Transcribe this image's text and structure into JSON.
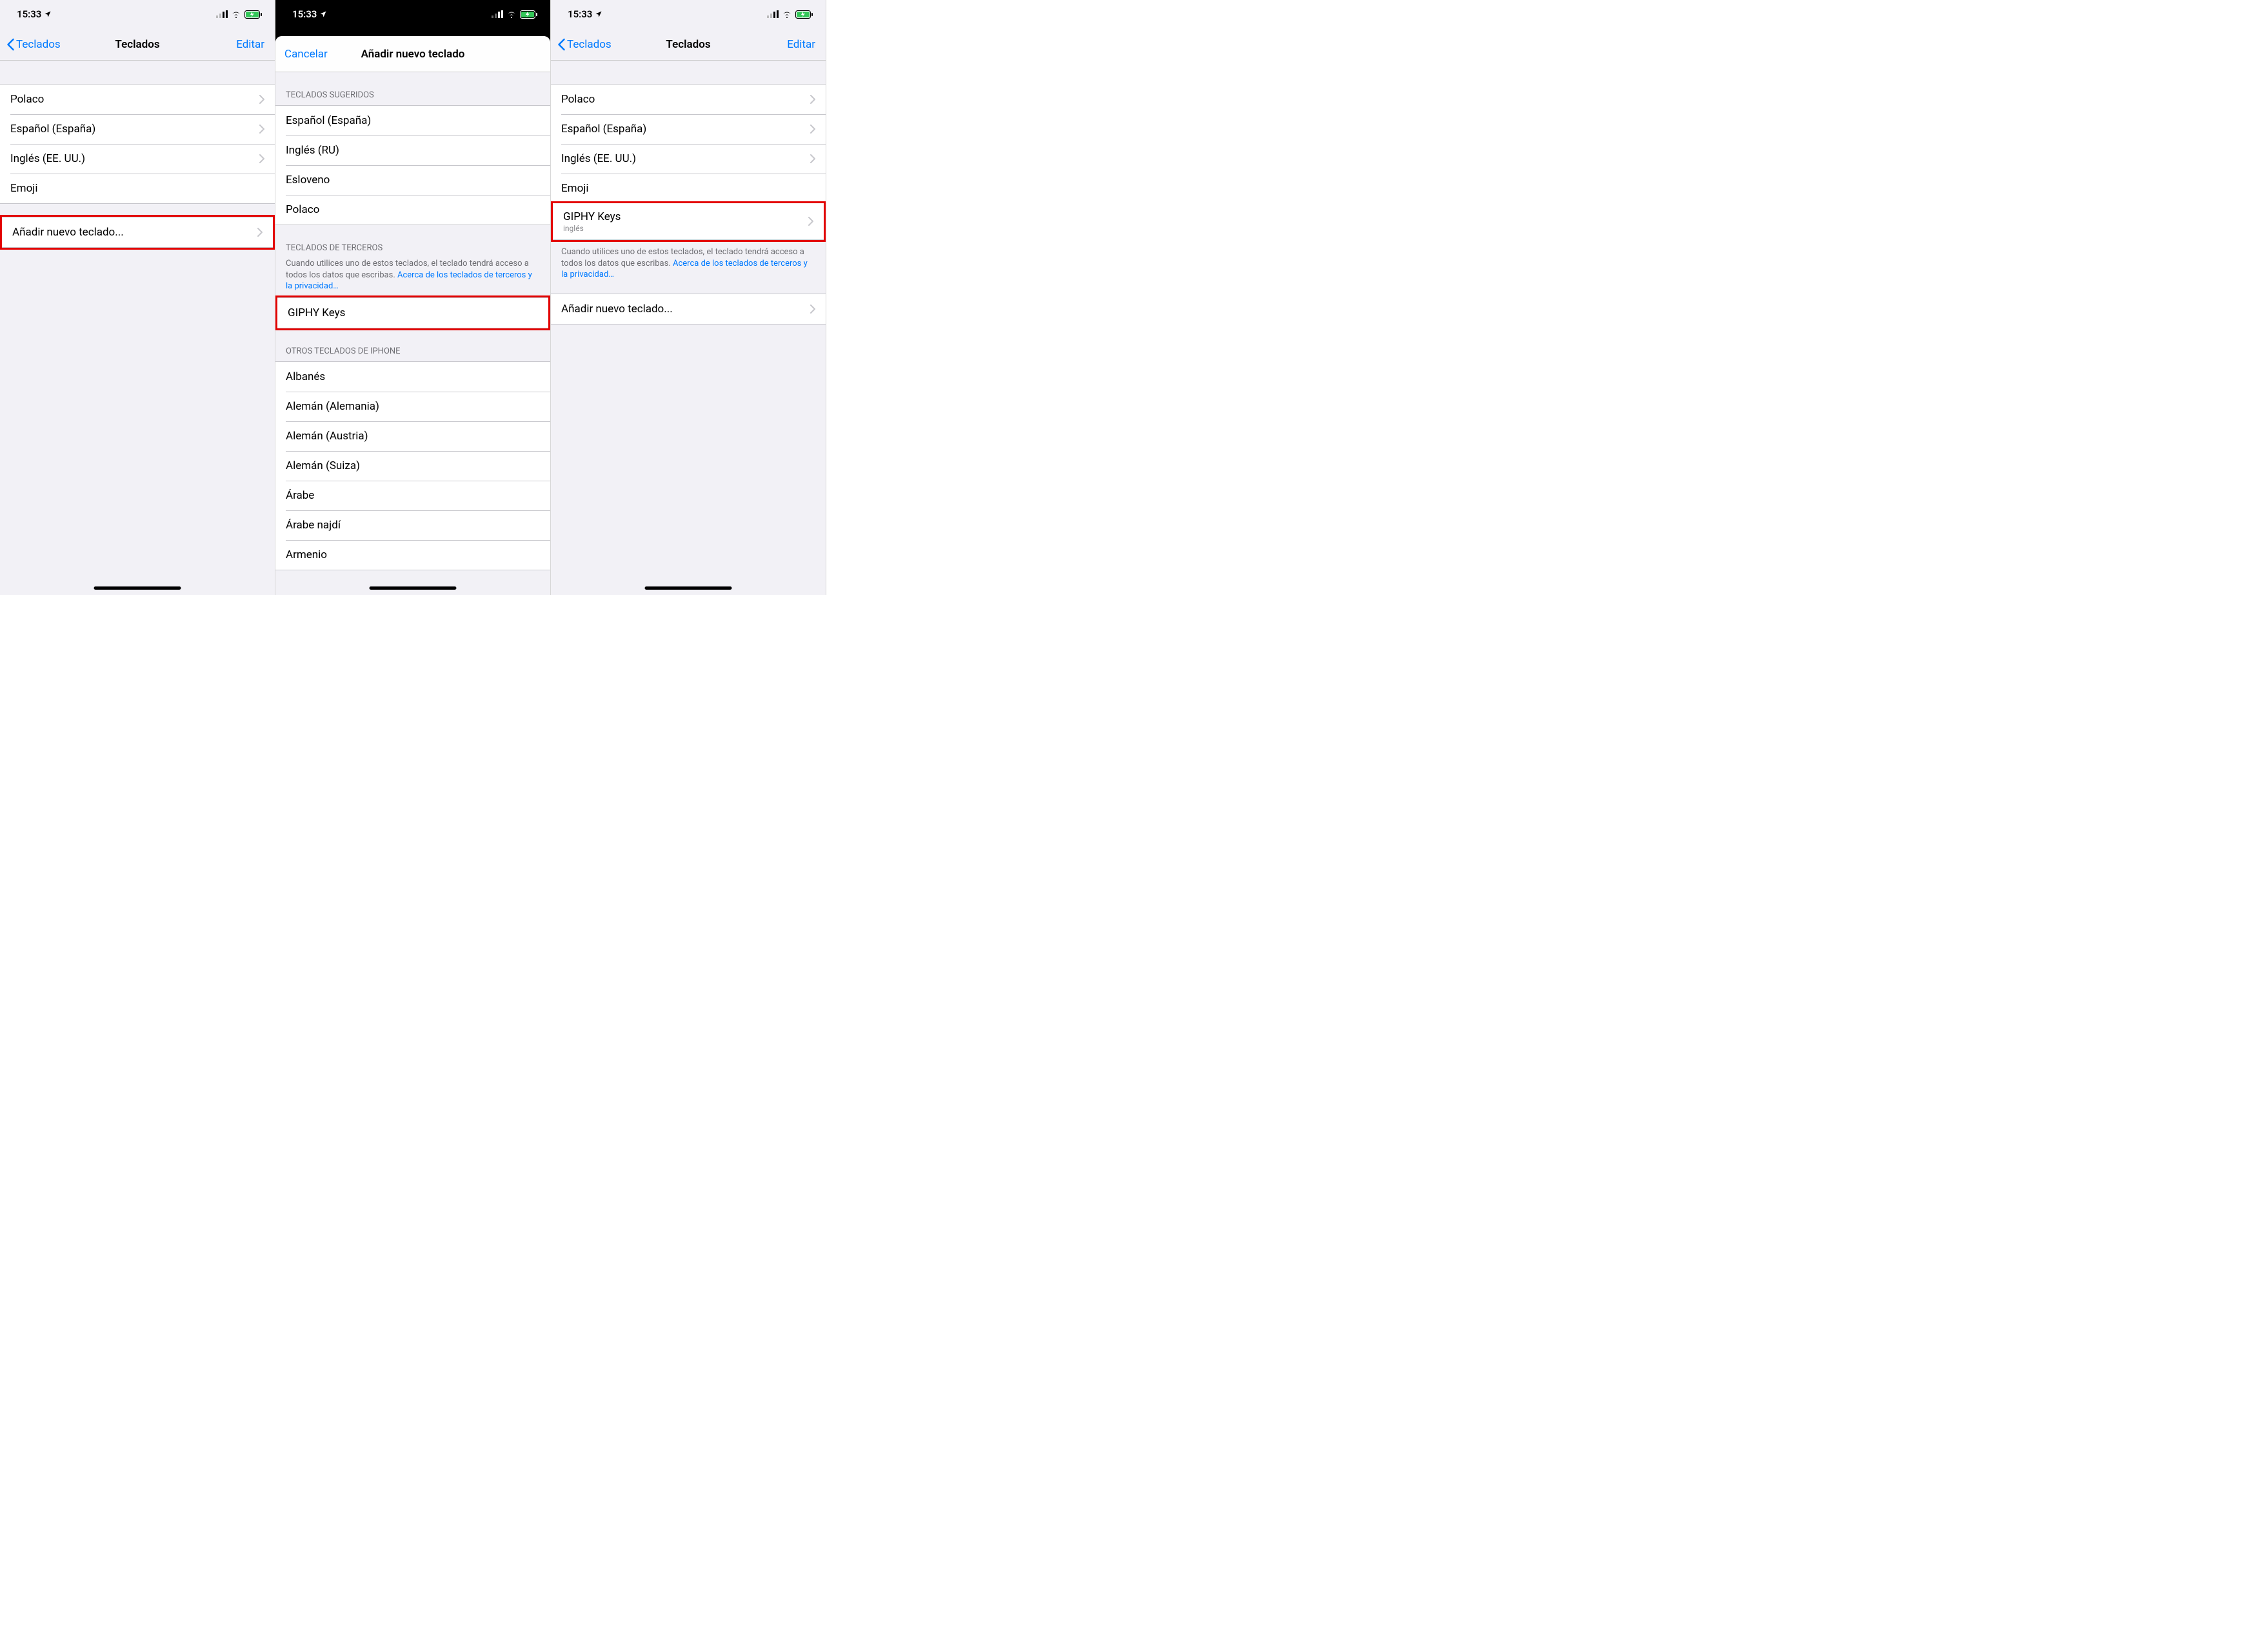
{
  "status": {
    "time": "15:33"
  },
  "s1": {
    "back": "Teclados",
    "title": "Teclados",
    "edit": "Editar",
    "rows": [
      "Polaco",
      "Español (España)",
      "Inglés (EE. UU.)",
      "Emoji"
    ],
    "add": "Añadir nuevo teclado..."
  },
  "s2": {
    "cancel": "Cancelar",
    "title": "Añadir nuevo teclado",
    "sec1_header": "TECLADOS SUGERIDOS",
    "sec1_rows": [
      "Español (España)",
      "Inglés (RU)",
      "Esloveno",
      "Polaco"
    ],
    "sec2_header": "TECLADOS DE TERCEROS",
    "sec2_desc": "Cuando utilices uno de estos teclados, el teclado tendrá acceso a todos los datos que escribas. ",
    "sec2_link": "Acerca de los teclados de terceros y la privacidad…",
    "sec2_rows": [
      "GIPHY Keys"
    ],
    "sec3_header": "OTROS TECLADOS DE IPHONE",
    "sec3_rows": [
      "Albanés",
      "Alemán (Alemania)",
      "Alemán (Austria)",
      "Alemán (Suiza)",
      "Árabe",
      "Árabe najdí",
      "Armenio"
    ]
  },
  "s3": {
    "back": "Teclados",
    "title": "Teclados",
    "edit": "Editar",
    "rows_plain": [
      "Polaco",
      "Español (España)",
      "Inglés (EE. UU.)",
      "Emoji"
    ],
    "giphy": "GIPHY Keys",
    "giphy_sub": "inglés",
    "note": "Cuando utilices uno de estos teclados, el teclado tendrá acceso a todos los datos que escribas. ",
    "note_link": "Acerca de los teclados de terceros y la privacidad…",
    "add": "Añadir nuevo teclado..."
  }
}
